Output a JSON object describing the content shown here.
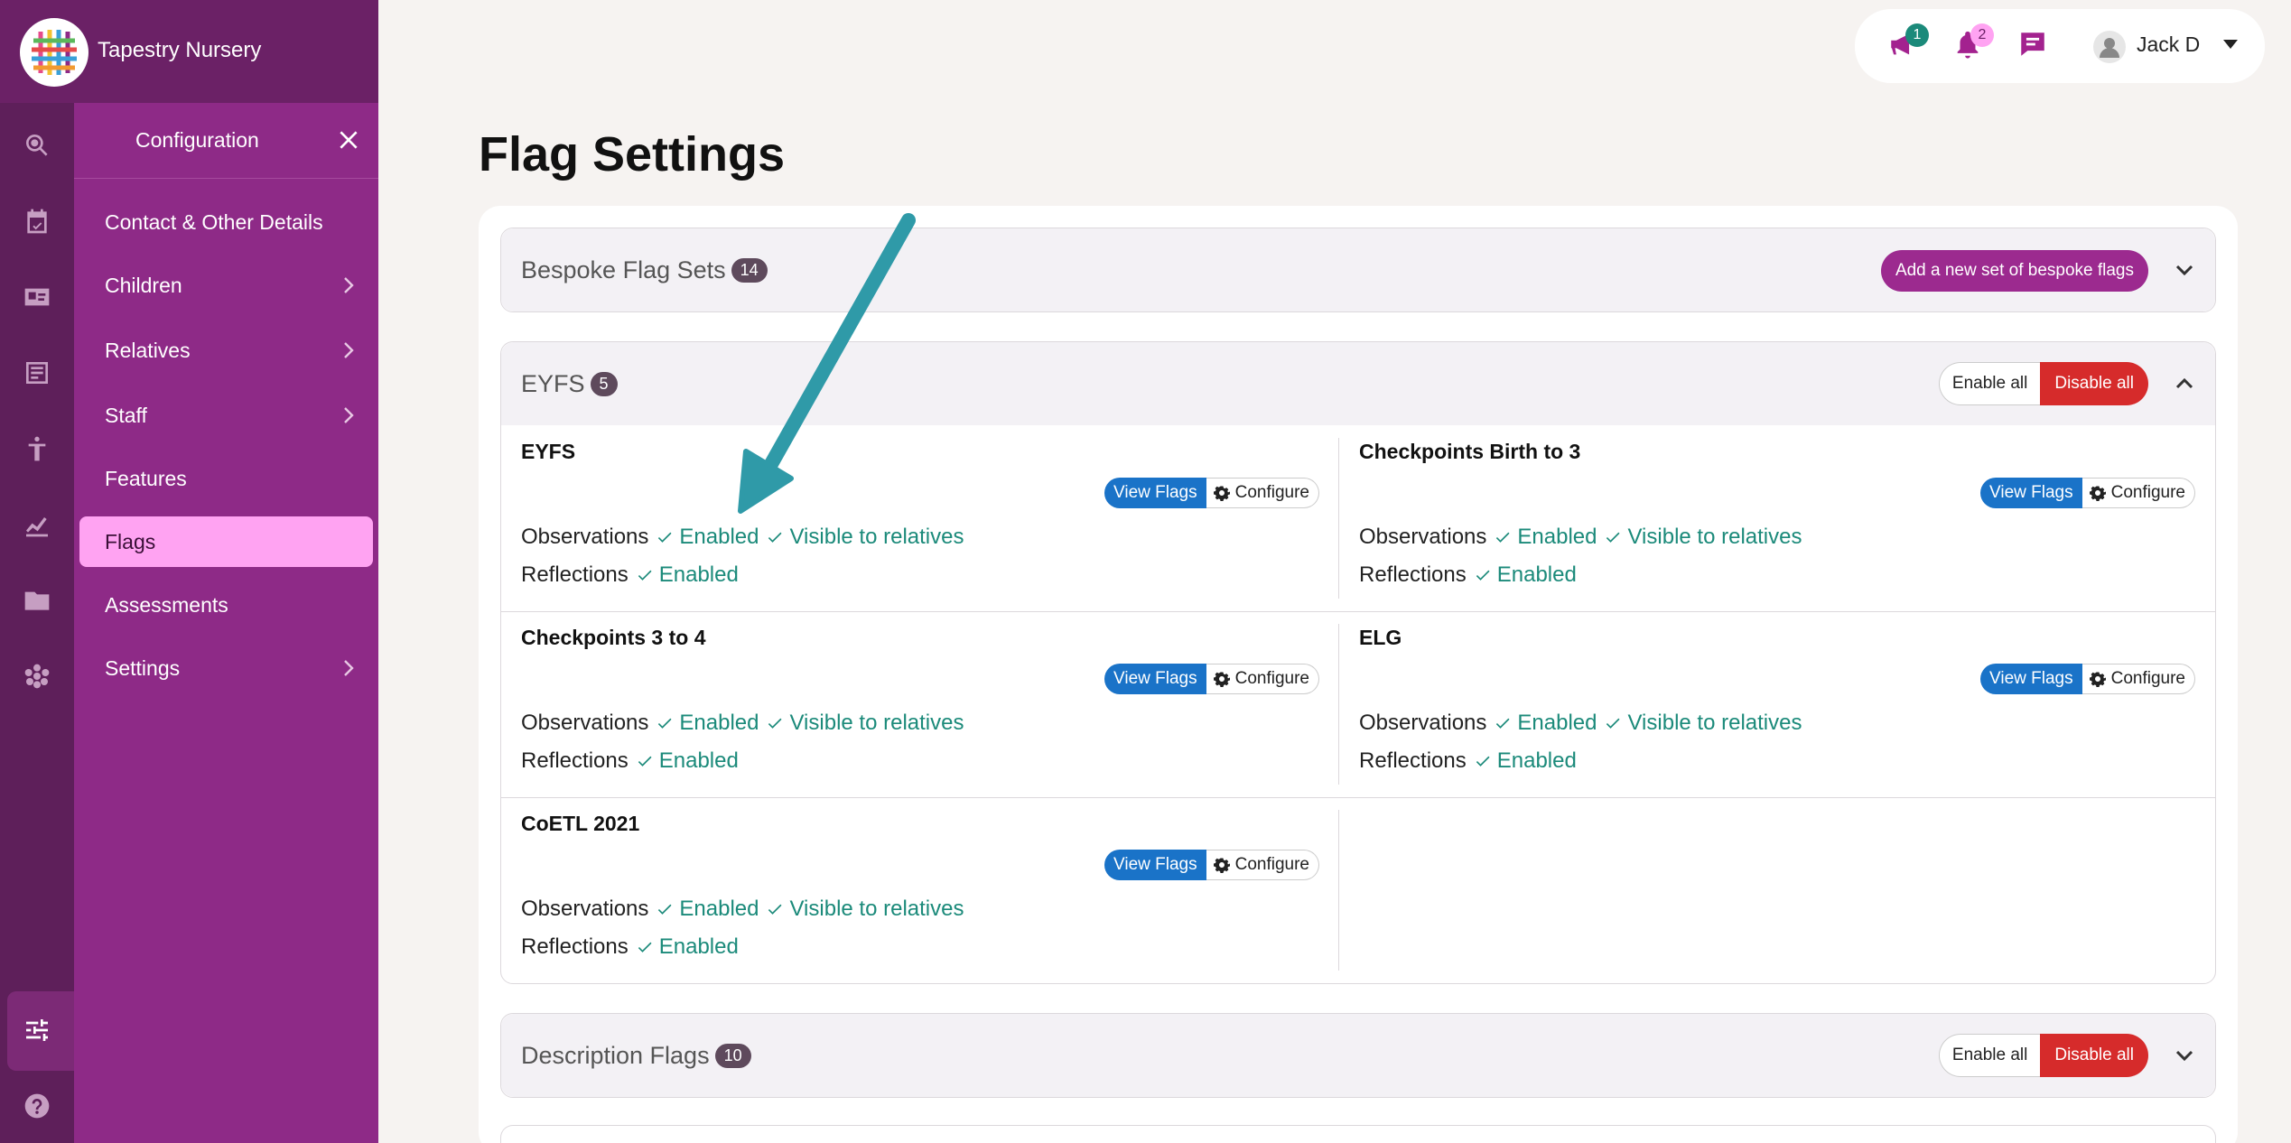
{
  "app": {
    "name": "Tapestry Nursery"
  },
  "panel": {
    "title": "Configuration",
    "items": [
      {
        "label": "Contact & Other Details",
        "has_submenu": false
      },
      {
        "label": "Children",
        "has_submenu": true
      },
      {
        "label": "Relatives",
        "has_submenu": true
      },
      {
        "label": "Staff",
        "has_submenu": true
      },
      {
        "label": "Features",
        "has_submenu": false
      },
      {
        "label": "Flags",
        "has_submenu": false,
        "active": true
      },
      {
        "label": "Assessments",
        "has_submenu": false
      },
      {
        "label": "Settings",
        "has_submenu": true
      }
    ]
  },
  "rail_icons": [
    "search-icon",
    "calendar-check-icon",
    "id-card-icon",
    "document-icon",
    "accessibility-icon",
    "chart-icon",
    "folder-icon",
    "flower-icon",
    "sliders-icon",
    "help-icon"
  ],
  "topbar": {
    "announcements_count": "1",
    "notifications_count": "2",
    "user_name": "Jack D"
  },
  "page": {
    "title": "Flag Settings"
  },
  "sections": {
    "bespoke": {
      "title": "Bespoke Flag Sets",
      "count": "14",
      "add_button": "Add a new set of bespoke flags"
    },
    "eyfs": {
      "title": "EYFS",
      "count": "5",
      "enable_all": "Enable all",
      "disable_all": "Disable all",
      "sets": [
        {
          "name": "EYFS"
        },
        {
          "name": "Checkpoints Birth to 3"
        },
        {
          "name": "Checkpoints 3 to 4"
        },
        {
          "name": "ELG"
        },
        {
          "name": "CoETL 2021"
        }
      ]
    },
    "description": {
      "title": "Description Flags",
      "count": "10",
      "enable_all": "Enable all",
      "disable_all": "Disable all"
    }
  },
  "labels": {
    "view_flags": "View Flags",
    "configure": "Configure",
    "observations": "Observations",
    "reflections": "Reflections",
    "enabled": "Enabled",
    "visible_to_relatives": "Visible to relatives"
  },
  "colors": {
    "sidebar": "#5e1f5a",
    "panel": "#8e2a87",
    "active_item": "#ffa3f2",
    "enabled_text": "#1b8a7a",
    "disable_button": "#d62b2b",
    "annotation_arrow": "#2f9aa8"
  }
}
